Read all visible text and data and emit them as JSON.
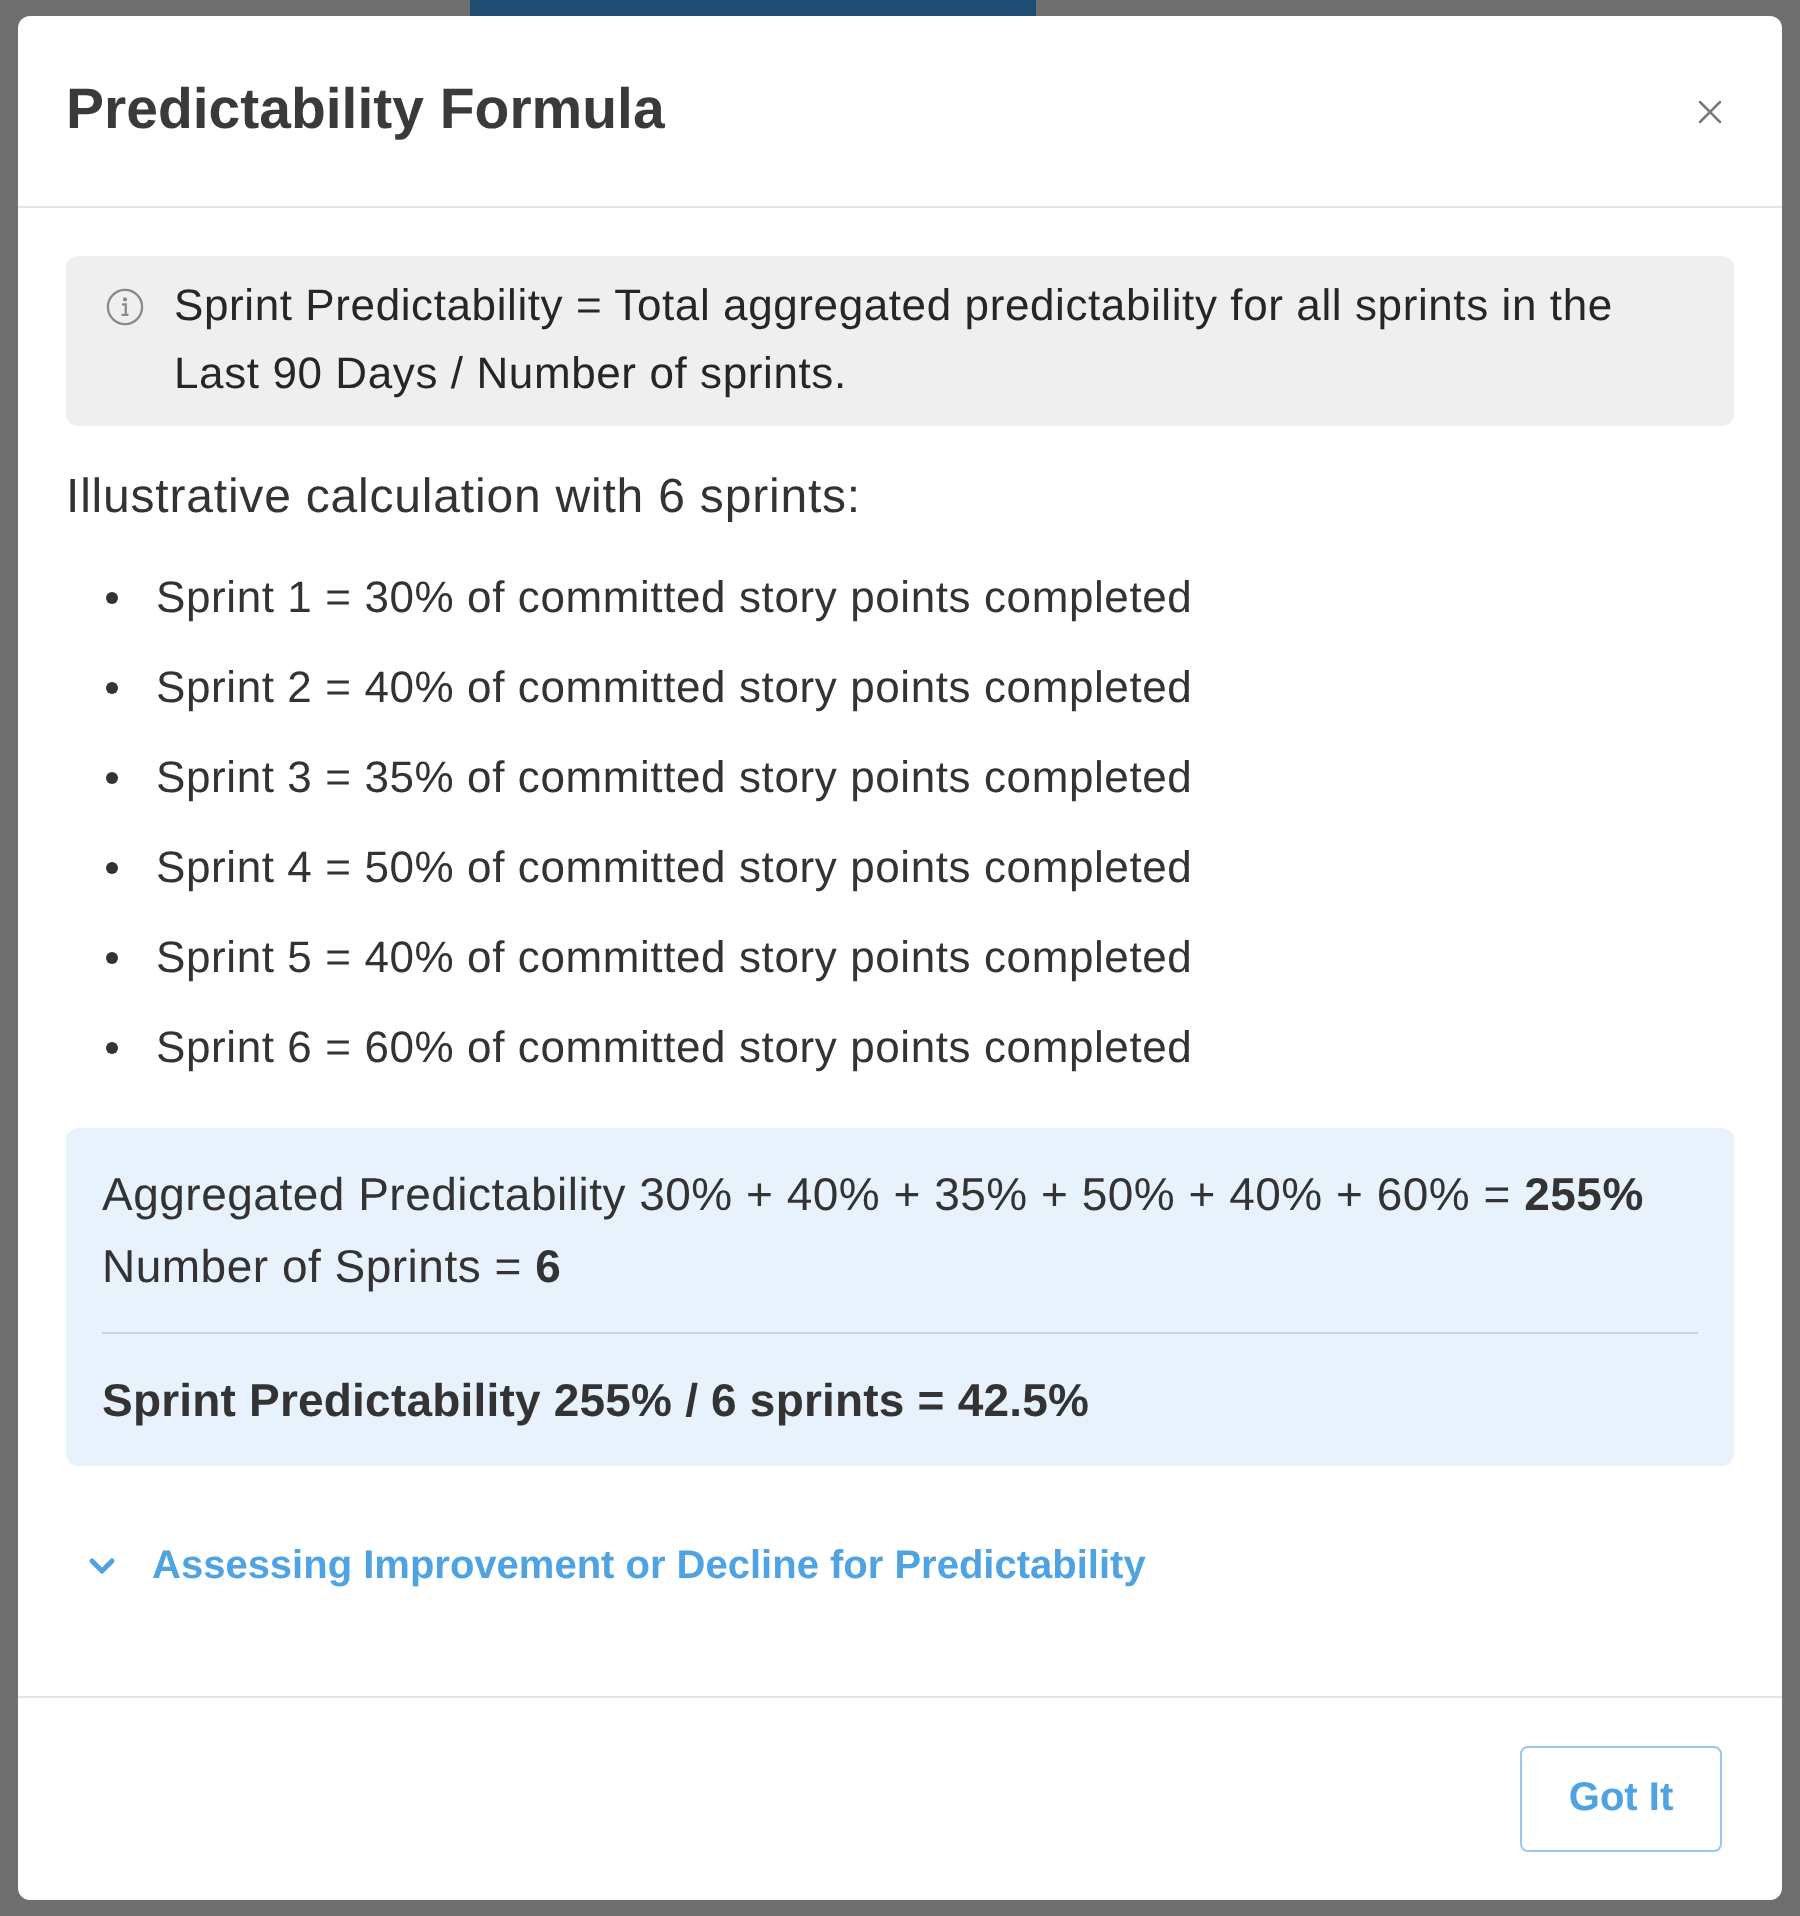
{
  "dialog": {
    "title": "Predictability Formula"
  },
  "info": {
    "text": "Sprint Predictability = Total aggregated predictability for all sprints in the Last 90 Days / Number of sprints."
  },
  "intro": "Illustrative calculation with 6 sprints:",
  "sprints": [
    "Sprint 1 = 30% of committed story points completed",
    "Sprint 2 = 40% of committed story points completed",
    "Sprint 3 = 35% of committed story points completed",
    "Sprint 4 = 50% of committed story points completed",
    "Sprint 5 = 40% of committed story points completed",
    "Sprint 6 = 60% of committed story points completed"
  ],
  "summary": {
    "lines": [
      "Aggregated Predictability 30% + 40% + 35% + 50% + 40% + 60% = **255%**",
      "Number of Sprints = **6**"
    ],
    "result": "Sprint Predictability 255% / 6 sprints = 42.5%"
  },
  "accordion": {
    "label": "Assessing Improvement or Decline for Predictability",
    "expanded": false
  },
  "footer": {
    "buttons": [
      "Got It"
    ]
  }
}
